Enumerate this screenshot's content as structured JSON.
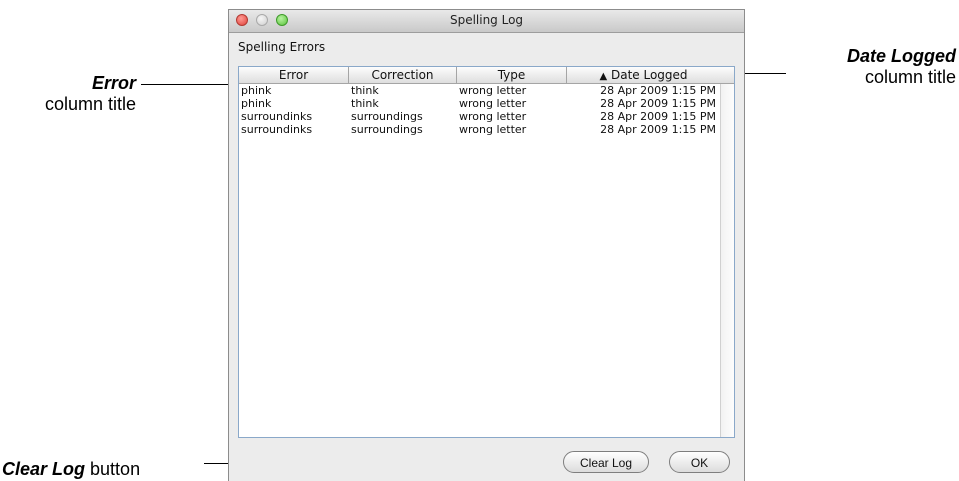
{
  "window": {
    "title": "Spelling Log"
  },
  "section_label": "Spelling Errors",
  "table": {
    "columns": [
      "Error",
      "Correction",
      "Type",
      "Date Logged"
    ],
    "sort_indicator": "▲",
    "rows": [
      [
        "phink",
        "think",
        "wrong letter",
        "28 Apr 2009 1:15 PM"
      ],
      [
        "phink",
        "think",
        "wrong letter",
        "28 Apr 2009 1:15 PM"
      ],
      [
        "surroundinks",
        "surroundings",
        "wrong letter",
        "28 Apr 2009 1:15 PM"
      ],
      [
        "surroundinks",
        "surroundings",
        "wrong letter",
        "28 Apr 2009 1:15 PM"
      ]
    ]
  },
  "buttons": {
    "clear_log": "Clear Log",
    "ok": "OK"
  },
  "callouts": {
    "error": {
      "term": "Error",
      "text": "column title"
    },
    "date_logged": {
      "term": "Date Logged",
      "text": "column title"
    },
    "clear_log": {
      "term": "Clear Log",
      "text": "button"
    }
  },
  "icons": {
    "close": "close-icon",
    "minimize": "minimize-icon",
    "zoom": "zoom-icon",
    "sort": "sort-ascending-icon"
  },
  "colors": {
    "close": "#e0413a",
    "minimize": "#cfcfcf",
    "zoom": "#5ac33a",
    "table_border": "#8aa8c9"
  }
}
